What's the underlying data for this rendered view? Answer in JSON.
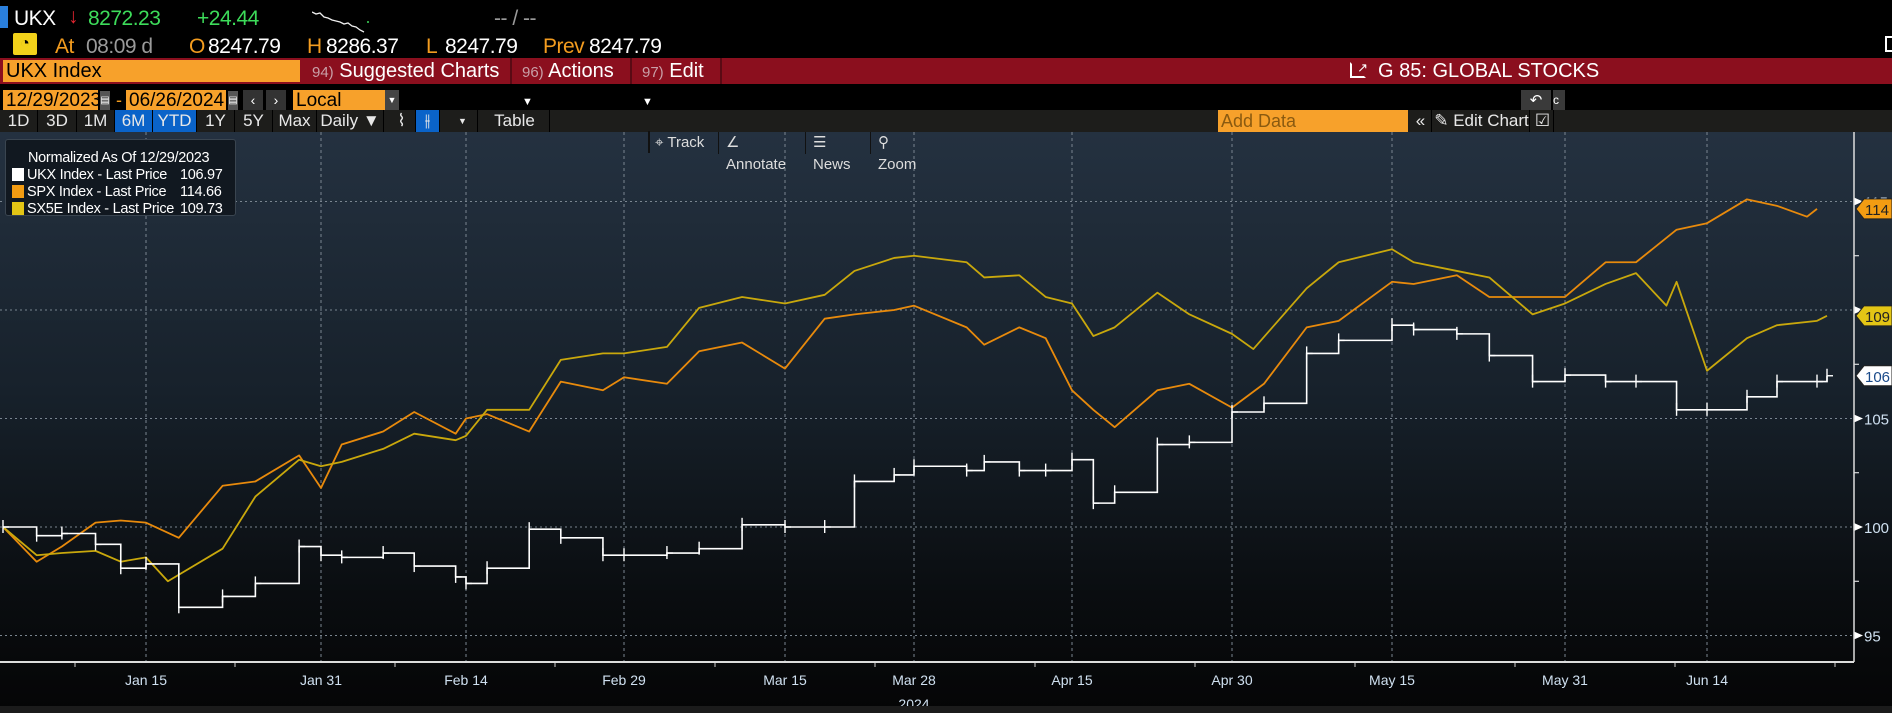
{
  "quote": {
    "ticker": "UKX",
    "direction_icon": "arrow-down-icon",
    "last": "8272.23",
    "change": "+24.44",
    "bid_ask": "-- / --",
    "at_label": "At",
    "time": "08:09 d",
    "open_label": "O",
    "open": "8247.79",
    "high_label": "H",
    "high": "8286.37",
    "low_label": "L",
    "low": "8247.79",
    "prev_label": "Prev",
    "prev": "8247.79"
  },
  "menubar": {
    "security": "UKX Index",
    "items": [
      {
        "num": "94)",
        "label": "Suggested Charts"
      },
      {
        "num": "96)",
        "label": "Actions"
      },
      {
        "num": "97)",
        "label": "Edit"
      }
    ],
    "chart_title": "G 85: GLOBAL STOCKS"
  },
  "range": {
    "start": "12/29/2023",
    "end": "06/26/2024",
    "separator": "-",
    "currency": "Local CCY"
  },
  "toolbar": {
    "periods": [
      "1D",
      "3D",
      "1M",
      "6M",
      "YTD",
      "1Y",
      "5Y",
      "Max"
    ],
    "active_periods": [
      "6M",
      "YTD"
    ],
    "frequency": "Daily",
    "table_label": "Table",
    "add_data_placeholder": "Add Data",
    "edit_chart_label": "Edit Chart"
  },
  "chart_tools": [
    "Track",
    "Annotate",
    "News",
    "Zoom"
  ],
  "colors": {
    "accent_orange": "#f7a12b",
    "menu_red": "#8b0f1e",
    "active_blue": "#0a63c9"
  },
  "chart_data": {
    "type": "line",
    "title": "",
    "legend_title": "Normalized As Of 12/29/2023",
    "legend_placement": "top-left",
    "grid": true,
    "ylim": [
      93,
      117
    ],
    "y_ticks": [
      95,
      100,
      105,
      110,
      115
    ],
    "x_ticks": [
      "Jan 15",
      "Jan 31",
      "Feb 14",
      "Feb 29",
      "Mar 15",
      "Mar 28",
      "Apr 15",
      "Apr 30",
      "May 15",
      "May 31",
      "Jun 14"
    ],
    "x_tick_dates": [
      "2024-01-15",
      "2024-01-31",
      "2024-02-14",
      "2024-02-29",
      "2024-03-15",
      "2024-03-28",
      "2024-04-15",
      "2024-04-30",
      "2024-05-15",
      "2024-05-31",
      "2024-06-14"
    ],
    "x_year_label": "2024",
    "xlim": [
      "2023-12-29",
      "2024-06-26"
    ],
    "series": [
      {
        "name": "UKX Index - Last Price",
        "last": "106.97",
        "axis_tag": "106",
        "color": "#ffffff",
        "style": "bar",
        "points": [
          [
            "2023-12-29",
            100.0
          ],
          [
            "2024-01-02",
            99.6
          ],
          [
            "2024-01-05",
            99.7
          ],
          [
            "2024-01-09",
            99.2
          ],
          [
            "2024-01-12",
            98.1
          ],
          [
            "2024-01-15",
            98.3
          ],
          [
            "2024-01-18",
            96.3
          ],
          [
            "2024-01-22",
            96.8
          ],
          [
            "2024-01-25",
            97.4
          ],
          [
            "2024-01-29",
            99.1
          ],
          [
            "2024-01-31",
            98.7
          ],
          [
            "2024-02-02",
            98.6
          ],
          [
            "2024-02-06",
            98.8
          ],
          [
            "2024-02-09",
            98.2
          ],
          [
            "2024-02-13",
            97.7
          ],
          [
            "2024-02-14",
            97.4
          ],
          [
            "2024-02-16",
            98.1
          ],
          [
            "2024-02-20",
            99.9
          ],
          [
            "2024-02-23",
            99.5
          ],
          [
            "2024-02-27",
            98.7
          ],
          [
            "2024-02-29",
            98.7
          ],
          [
            "2024-03-04",
            98.8
          ],
          [
            "2024-03-07",
            99.0
          ],
          [
            "2024-03-11",
            100.1
          ],
          [
            "2024-03-15",
            100.0
          ],
          [
            "2024-03-19",
            100.0
          ],
          [
            "2024-03-22",
            102.1
          ],
          [
            "2024-03-26",
            102.4
          ],
          [
            "2024-03-28",
            102.8
          ],
          [
            "2024-04-03",
            102.6
          ],
          [
            "2024-04-05",
            103.0
          ],
          [
            "2024-04-09",
            102.6
          ],
          [
            "2024-04-12",
            102.6
          ],
          [
            "2024-04-15",
            103.1
          ],
          [
            "2024-04-17",
            101.1
          ],
          [
            "2024-04-19",
            101.6
          ],
          [
            "2024-04-23",
            103.8
          ],
          [
            "2024-04-26",
            103.9
          ],
          [
            "2024-04-30",
            105.3
          ],
          [
            "2024-05-03",
            105.7
          ],
          [
            "2024-05-07",
            108.0
          ],
          [
            "2024-05-10",
            108.6
          ],
          [
            "2024-05-15",
            109.3
          ],
          [
            "2024-05-17",
            109.1
          ],
          [
            "2024-05-21",
            108.9
          ],
          [
            "2024-05-24",
            107.9
          ],
          [
            "2024-05-28",
            106.7
          ],
          [
            "2024-05-31",
            107.0
          ],
          [
            "2024-06-04",
            106.7
          ],
          [
            "2024-06-07",
            106.7
          ],
          [
            "2024-06-11",
            105.4
          ],
          [
            "2024-06-14",
            105.4
          ],
          [
            "2024-06-18",
            106.0
          ],
          [
            "2024-06-21",
            106.7
          ],
          [
            "2024-06-25",
            106.7
          ],
          [
            "2024-06-26",
            106.97
          ]
        ]
      },
      {
        "name": "SPX Index - Last Price",
        "last": "114.66",
        "axis_tag": "114",
        "color": "#e88a0c",
        "style": "line",
        "points": [
          [
            "2023-12-29",
            100.0
          ],
          [
            "2024-01-02",
            98.4
          ],
          [
            "2024-01-05",
            99.1
          ],
          [
            "2024-01-09",
            100.2
          ],
          [
            "2024-01-12",
            100.3
          ],
          [
            "2024-01-15",
            100.2
          ],
          [
            "2024-01-18",
            99.5
          ],
          [
            "2024-01-22",
            101.9
          ],
          [
            "2024-01-25",
            102.1
          ],
          [
            "2024-01-29",
            103.3
          ],
          [
            "2024-01-31",
            101.8
          ],
          [
            "2024-02-02",
            103.8
          ],
          [
            "2024-02-06",
            104.4
          ],
          [
            "2024-02-09",
            105.3
          ],
          [
            "2024-02-13",
            104.3
          ],
          [
            "2024-02-14",
            105.0
          ],
          [
            "2024-02-16",
            105.2
          ],
          [
            "2024-02-20",
            104.4
          ],
          [
            "2024-02-23",
            106.7
          ],
          [
            "2024-02-27",
            106.3
          ],
          [
            "2024-02-29",
            106.9
          ],
          [
            "2024-03-04",
            106.6
          ],
          [
            "2024-03-07",
            108.1
          ],
          [
            "2024-03-11",
            108.5
          ],
          [
            "2024-03-15",
            107.3
          ],
          [
            "2024-03-19",
            109.6
          ],
          [
            "2024-03-22",
            109.8
          ],
          [
            "2024-03-26",
            110.0
          ],
          [
            "2024-03-28",
            110.2
          ],
          [
            "2024-04-03",
            109.2
          ],
          [
            "2024-04-05",
            108.4
          ],
          [
            "2024-04-09",
            109.2
          ],
          [
            "2024-04-12",
            108.7
          ],
          [
            "2024-04-15",
            106.3
          ],
          [
            "2024-04-17",
            105.4
          ],
          [
            "2024-04-19",
            104.6
          ],
          [
            "2024-04-23",
            106.3
          ],
          [
            "2024-04-26",
            106.6
          ],
          [
            "2024-04-30",
            105.5
          ],
          [
            "2024-05-03",
            106.6
          ],
          [
            "2024-05-07",
            109.2
          ],
          [
            "2024-05-10",
            109.5
          ],
          [
            "2024-05-15",
            111.3
          ],
          [
            "2024-05-17",
            111.2
          ],
          [
            "2024-05-21",
            111.6
          ],
          [
            "2024-05-24",
            110.6
          ],
          [
            "2024-05-28",
            110.6
          ],
          [
            "2024-05-31",
            110.6
          ],
          [
            "2024-06-04",
            112.2
          ],
          [
            "2024-06-07",
            112.2
          ],
          [
            "2024-06-11",
            113.7
          ],
          [
            "2024-06-14",
            114.0
          ],
          [
            "2024-06-18",
            115.1
          ],
          [
            "2024-06-21",
            114.8
          ],
          [
            "2024-06-24",
            114.3
          ],
          [
            "2024-06-25",
            114.66
          ]
        ]
      },
      {
        "name": "SX5E Index - Last Price",
        "last": "109.73",
        "axis_tag": "109",
        "color": "#c9a80c",
        "style": "line",
        "points": [
          [
            "2023-12-29",
            100.0
          ],
          [
            "2024-01-02",
            98.7
          ],
          [
            "2024-01-05",
            98.8
          ],
          [
            "2024-01-09",
            98.9
          ],
          [
            "2024-01-12",
            98.4
          ],
          [
            "2024-01-15",
            98.6
          ],
          [
            "2024-01-17",
            97.5
          ],
          [
            "2024-01-22",
            99.0
          ],
          [
            "2024-01-25",
            101.4
          ],
          [
            "2024-01-29",
            103.1
          ],
          [
            "2024-01-31",
            102.8
          ],
          [
            "2024-02-02",
            103.0
          ],
          [
            "2024-02-06",
            103.6
          ],
          [
            "2024-02-09",
            104.3
          ],
          [
            "2024-02-13",
            104.0
          ],
          [
            "2024-02-14",
            104.2
          ],
          [
            "2024-02-16",
            105.4
          ],
          [
            "2024-02-20",
            105.4
          ],
          [
            "2024-02-23",
            107.7
          ],
          [
            "2024-02-27",
            108.0
          ],
          [
            "2024-02-29",
            108.0
          ],
          [
            "2024-03-04",
            108.3
          ],
          [
            "2024-03-07",
            110.1
          ],
          [
            "2024-03-11",
            110.6
          ],
          [
            "2024-03-15",
            110.3
          ],
          [
            "2024-03-19",
            110.7
          ],
          [
            "2024-03-22",
            111.8
          ],
          [
            "2024-03-26",
            112.4
          ],
          [
            "2024-03-28",
            112.5
          ],
          [
            "2024-04-03",
            112.2
          ],
          [
            "2024-04-05",
            111.5
          ],
          [
            "2024-04-09",
            111.6
          ],
          [
            "2024-04-12",
            110.6
          ],
          [
            "2024-04-15",
            110.3
          ],
          [
            "2024-04-17",
            108.8
          ],
          [
            "2024-04-19",
            109.2
          ],
          [
            "2024-04-23",
            110.8
          ],
          [
            "2024-04-26",
            109.8
          ],
          [
            "2024-04-30",
            108.9
          ],
          [
            "2024-05-02",
            108.2
          ],
          [
            "2024-05-07",
            111.0
          ],
          [
            "2024-05-10",
            112.2
          ],
          [
            "2024-05-15",
            112.8
          ],
          [
            "2024-05-17",
            112.2
          ],
          [
            "2024-05-21",
            111.8
          ],
          [
            "2024-05-24",
            111.5
          ],
          [
            "2024-05-28",
            109.8
          ],
          [
            "2024-05-31",
            110.3
          ],
          [
            "2024-06-04",
            111.2
          ],
          [
            "2024-06-07",
            111.7
          ],
          [
            "2024-06-10",
            110.2
          ],
          [
            "2024-06-11",
            111.3
          ],
          [
            "2024-06-14",
            107.2
          ],
          [
            "2024-06-18",
            108.7
          ],
          [
            "2024-06-21",
            109.3
          ],
          [
            "2024-06-25",
            109.5
          ],
          [
            "2024-06-26",
            109.73
          ]
        ]
      }
    ]
  }
}
